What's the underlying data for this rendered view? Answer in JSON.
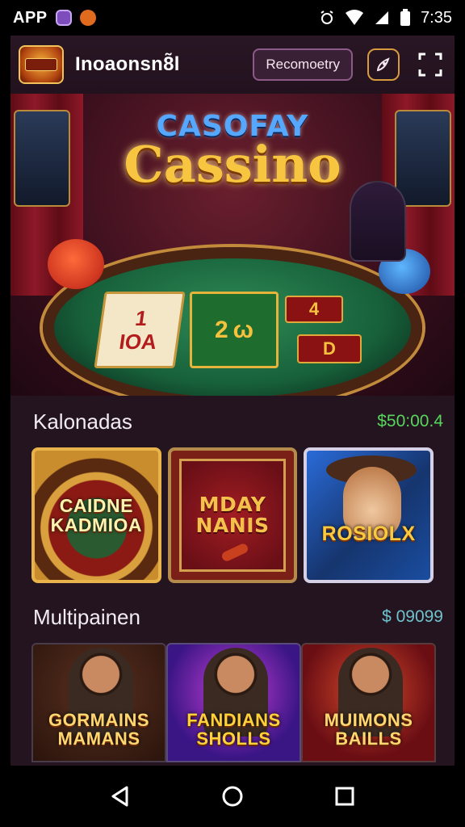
{
  "status_bar": {
    "app_label": "APP",
    "time": "7:35",
    "left_icons": [
      "app-icon-purple",
      "app-icon-orange"
    ],
    "right_icons": [
      "alarm-icon",
      "wifi-icon",
      "signal-icon",
      "battery-icon"
    ]
  },
  "header": {
    "title": "Inoaonsn8̃l",
    "recommend_button": "Recomoetry",
    "icons": [
      "rocket-icon",
      "scan-icon"
    ]
  },
  "hero": {
    "subtitle": "CASOFAY",
    "title": "Cassino",
    "cards": [
      "1\nIOA",
      "2 ω",
      "4",
      "D"
    ]
  },
  "section1": {
    "title": "Kalonadas",
    "amount": "$50:00.4",
    "tiles": [
      {
        "label": "CAIDNE KADMIOA"
      },
      {
        "label": "MDAY NANIS"
      },
      {
        "label": "ROSIOLX"
      }
    ]
  },
  "section2": {
    "title": "Multipainen",
    "amount": "$ 09099",
    "tiles": [
      {
        "label": "GORMAINS MAMANS"
      },
      {
        "label": "FANDIANS SHOLLS"
      },
      {
        "label": "MUIMONS BAILLS"
      }
    ]
  },
  "colors": {
    "app_bg": "#241420",
    "amount_green": "#57d65c",
    "amount_teal": "#6fc3cc",
    "gold": "#f7c540"
  },
  "nav": [
    "back-icon",
    "home-icon",
    "recents-icon"
  ]
}
